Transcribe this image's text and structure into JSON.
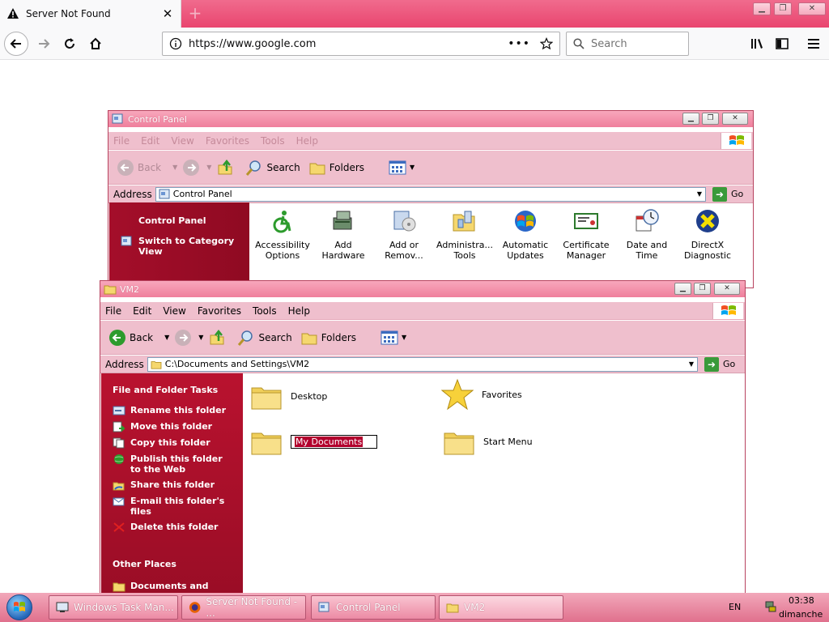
{
  "browser": {
    "tab_title": "Server Not Found",
    "url": "https://www.google.com",
    "search_placeholder": "Search"
  },
  "control_panel": {
    "title": "Control Panel",
    "menu": [
      "File",
      "Edit",
      "View",
      "Favorites",
      "Tools",
      "Help"
    ],
    "toolbar": {
      "back": "Back",
      "search": "Search",
      "folders": "Folders"
    },
    "address_label": "Address",
    "address_value": "Control Panel",
    "go_label": "Go",
    "sidebar": {
      "title": "Control Panel",
      "switch_label": "Switch to Category View"
    },
    "items": [
      {
        "label": "Accessibility Options",
        "icon": "accessibility-icon"
      },
      {
        "label": "Add Hardware",
        "icon": "add-hardware-icon"
      },
      {
        "label": "Add or Remov...",
        "icon": "add-remove-programs-icon"
      },
      {
        "label": "Administra... Tools",
        "icon": "administrative-tools-icon"
      },
      {
        "label": "Automatic Updates",
        "icon": "automatic-updates-icon"
      },
      {
        "label": "Certificate Manager",
        "icon": "certificate-icon"
      },
      {
        "label": "Date and Time",
        "icon": "date-time-icon"
      },
      {
        "label": "DirectX Diagnostic",
        "icon": "directx-icon"
      }
    ]
  },
  "vm2": {
    "title": "VM2",
    "menu": [
      "File",
      "Edit",
      "View",
      "Favorites",
      "Tools",
      "Help"
    ],
    "toolbar": {
      "back": "Back",
      "search": "Search",
      "folders": "Folders"
    },
    "address_label": "Address",
    "address_value": "C:\\Documents and Settings\\VM2",
    "go_label": "Go",
    "tasks_header": "File and Folder Tasks",
    "tasks": [
      "Rename this folder",
      "Move this folder",
      "Copy this folder",
      "Publish this folder to the Web",
      "Share this folder",
      "E-mail this folder's files",
      "Delete this folder"
    ],
    "other_places_header": "Other Places",
    "other_places": [
      "Documents and Settings"
    ],
    "folders": [
      {
        "label": "Desktop",
        "icon": "folder-icon"
      },
      {
        "label": "Favorites",
        "icon": "star-icon"
      },
      {
        "label": "My Documents",
        "icon": "folder-icon"
      },
      {
        "label": "Start Menu",
        "icon": "folder-icon"
      }
    ]
  },
  "taskbar": {
    "buttons": [
      "Windows Task Man...",
      "Server Not Found - ...",
      "Control Panel",
      "VM2"
    ],
    "language": "EN",
    "time": "03:38",
    "day": "dimanche"
  },
  "colors": {
    "xp_title": "#f08aa6",
    "xp_bar": "#efbfcd",
    "sidebar_red": "#a40e2a",
    "selection": "#b2002d",
    "firefox_tabbar": "#ec5a7e"
  }
}
